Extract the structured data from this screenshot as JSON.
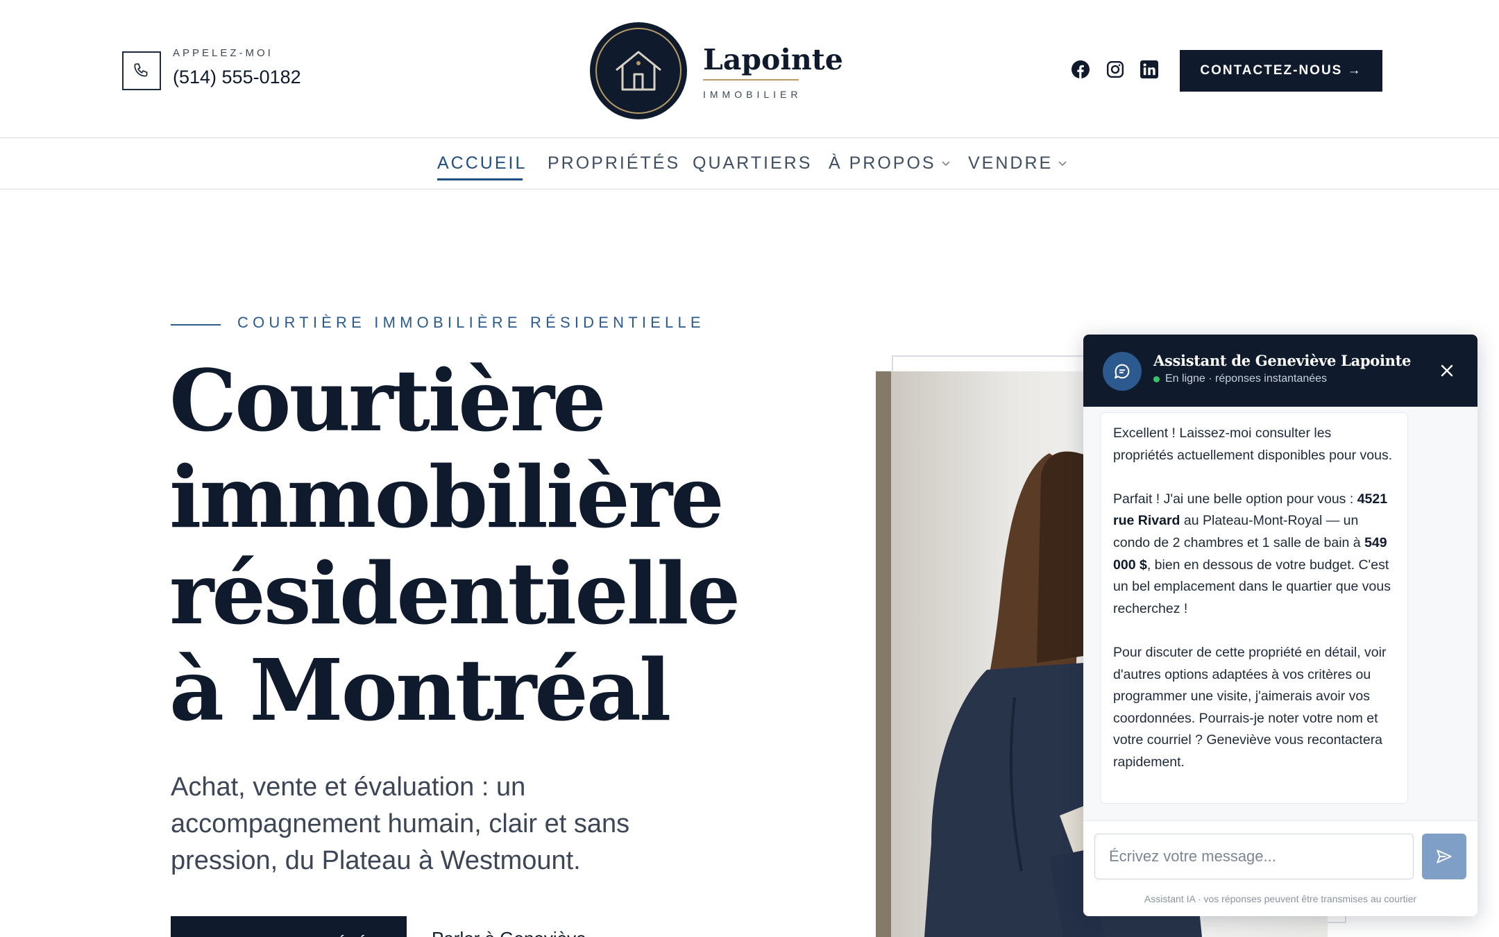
{
  "header": {
    "phone_label": "APPELEZ-MOI",
    "phone_number": "(514) 555-0182",
    "logo_name": "Lapointe",
    "logo_sub": "IMMOBILIER",
    "cta": "CONTACTEZ-NOUS →",
    "social_icons": [
      "facebook-icon",
      "instagram-icon",
      "linkedin-icon"
    ]
  },
  "nav": {
    "items": [
      {
        "label": "ACCUEIL",
        "active": true
      },
      {
        "label": "PROPRIÉTÉS"
      },
      {
        "label": "QUARTIERS"
      },
      {
        "label": "À PROPOS",
        "dropdown": true
      },
      {
        "label": "VENDRE",
        "dropdown": true
      }
    ]
  },
  "hero": {
    "eyebrow": "COURTIÈRE IMMOBILIÈRE RÉSIDENTIELLE",
    "title_lines": [
      "Courtière",
      "immobilière",
      "résidentielle",
      "à Montréal"
    ],
    "subtitle": "Achat, vente et évaluation : un accompagnement humain, clair et sans pression, du Plateau à Westmount.",
    "primary_button": "VOIR LES PROPRIÉTÉS",
    "secondary_link": "Parler à Geneviève"
  },
  "chat": {
    "title": "Assistant de Geneviève Lapointe",
    "status": "En ligne · réponses instantanées",
    "message": {
      "p1": "Excellent ! Laissez-moi consulter les propriétés actuellement disponibles pour vous.",
      "p2_a": "Parfait ! J'ai une belle option pour vous : ",
      "p2_address": "4521 rue Rivard",
      "p2_b": " au Plateau-Mont-Royal — un condo de 2 chambres et 1 salle de bain à ",
      "p2_price": "549 000 $",
      "p2_c": ", bien en dessous de votre budget. C'est un bel emplacement dans le quartier que vous recherchez !",
      "p3": "Pour discuter de cette propriété en détail, voir d'autres options adaptées à vos critères ou programmer une visite, j'aimerais avoir vos coordonnées. Pourrais-je noter votre nom et votre courriel ? Geneviève vous recontactera rapidement."
    },
    "input_placeholder": "Écrivez votre message...",
    "disclaimer": "Assistant IA · vos réponses peuvent être transmises au courtier"
  },
  "colors": {
    "navy": "#0f1b2d",
    "accent_blue": "#1f4e82",
    "gold": "#b59a68",
    "online": "#39c26b"
  }
}
